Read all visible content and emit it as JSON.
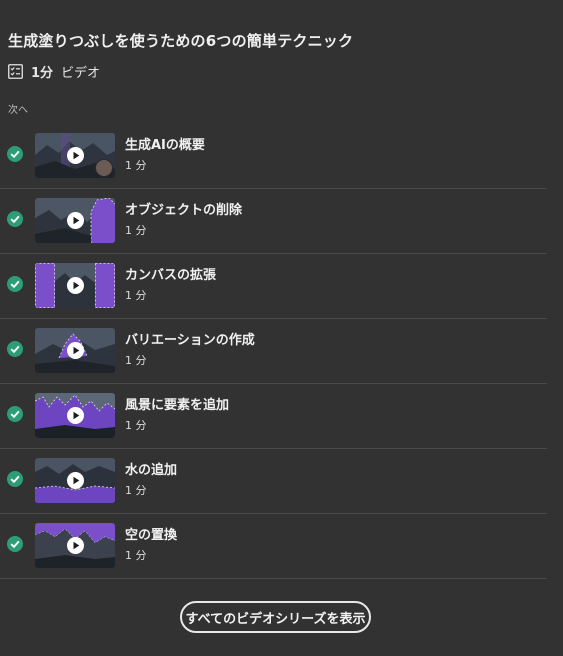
{
  "header": {
    "title": "生成塗りつぶしを使うための6つの簡単テクニック",
    "count": "1分",
    "type": "ビデオ",
    "next_label": "次へ"
  },
  "colors": {
    "background": "#323232",
    "check": "#2d9d78",
    "accent_purple": "#7d4bd6"
  },
  "lessons": [
    {
      "title": "生成AIの概要",
      "duration": "1 分",
      "completed": true
    },
    {
      "title": "オブジェクトの削除",
      "duration": "1 分",
      "completed": true
    },
    {
      "title": "カンバスの拡張",
      "duration": "1 分",
      "completed": true
    },
    {
      "title": "バリエーションの作成",
      "duration": "1 分",
      "completed": true
    },
    {
      "title": "風景に要素を追加",
      "duration": "1 分",
      "completed": true
    },
    {
      "title": "水の追加",
      "duration": "1 分",
      "completed": true
    },
    {
      "title": "空の置換",
      "duration": "1 分",
      "completed": true
    }
  ],
  "footer": {
    "series_button": "すべてのビデオシリーズを表示"
  }
}
